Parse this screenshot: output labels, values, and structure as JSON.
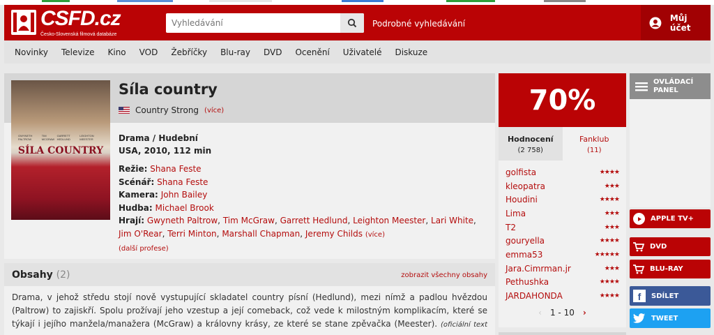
{
  "site": {
    "logo_text": "CSFD.cz",
    "logo_subtitle": "Česko-Slovenská filmová databáze",
    "search_placeholder": "Vyhledávání",
    "advanced_search": "Podrobné vyhledávání",
    "account": "Můj účet",
    "accent": "#ba0305"
  },
  "nav": [
    "Novinky",
    "Televize",
    "Kino",
    "VOD",
    "Žebříčky",
    "Blu-ray",
    "DVD",
    "Ocenění",
    "Uživatelé",
    "Diskuze"
  ],
  "film": {
    "title": "Síla country",
    "original_title": "Country Strong",
    "more": "(více)",
    "genre": "Drama / Hudební",
    "origin": "USA, 2010, 112 min",
    "poster_title": "SÍLA COUNTRY",
    "poster_names": [
      "GWYNETH PALTROW",
      "TIM MCGRAW",
      "GARRETT HEDLUND",
      "LEIGHTON MEESTER"
    ],
    "direction_label": "Režie:",
    "direction": "Shana Feste",
    "screenplay_label": "Scénář:",
    "screenplay": "Shana Feste",
    "camera_label": "Kamera:",
    "camera": "John Bailey",
    "music_label": "Hudba:",
    "music": "Michael Brook",
    "cast_label": "Hrají:",
    "cast": [
      "Gwyneth Paltrow",
      "Tim McGraw",
      "Garrett Hedlund",
      "Leighton Meester",
      "Lari White",
      "Jim O'Rear",
      "Terri Minton",
      "Marshall Chapman",
      "Jeremy Childs"
    ],
    "cast_more": "(více)",
    "more_professions": "(další profese)"
  },
  "plots": {
    "title": "Obsahy",
    "count": "(2)",
    "show_all": "zobrazit všechny obsahy",
    "text": "Drama, v jehož středu stojí nově vystupující skladatel country písní (Hedlund), mezi nímž a padlou hvězdou (Paltrow) to zajiskří. Spolu prožívají jeho vzestup a její comeback, což vede k milostným komplikacím, které se týkají i jejího manžela/manažera (McGraw) a královny krásy, ze které se stane zpěvačka (Meester).",
    "source": "(oficiální text distributora)"
  },
  "rating": {
    "value": "70%",
    "tab_ratings": "Hodnocení",
    "tab_ratings_count": "(2 758)",
    "tab_fanclub": "Fanklub",
    "tab_fanclub_count": "(11)",
    "users": [
      {
        "name": "golfista",
        "stars": 4
      },
      {
        "name": "kleopatra",
        "stars": 3
      },
      {
        "name": "Houdini",
        "stars": 4
      },
      {
        "name": "Lima",
        "stars": 3
      },
      {
        "name": "T2",
        "stars": 3
      },
      {
        "name": "gouryella",
        "stars": 4
      },
      {
        "name": "emma53",
        "stars": 5
      },
      {
        "name": "Jara.Cimrman.jr",
        "stars": 3
      },
      {
        "name": "Pethushka",
        "stars": 4
      },
      {
        "name": "JARDAHONDA",
        "stars": 4
      }
    ],
    "pager": "1 - 10",
    "pager_prev": "‹",
    "pager_next": "›"
  },
  "side": {
    "panel": "OVLÁDACÍ PANEL",
    "apple": "APPLE TV+",
    "dvd": "DVD",
    "bluray": "BLU-RAY",
    "share": "SDÍLET",
    "tweet": "TWEET"
  }
}
